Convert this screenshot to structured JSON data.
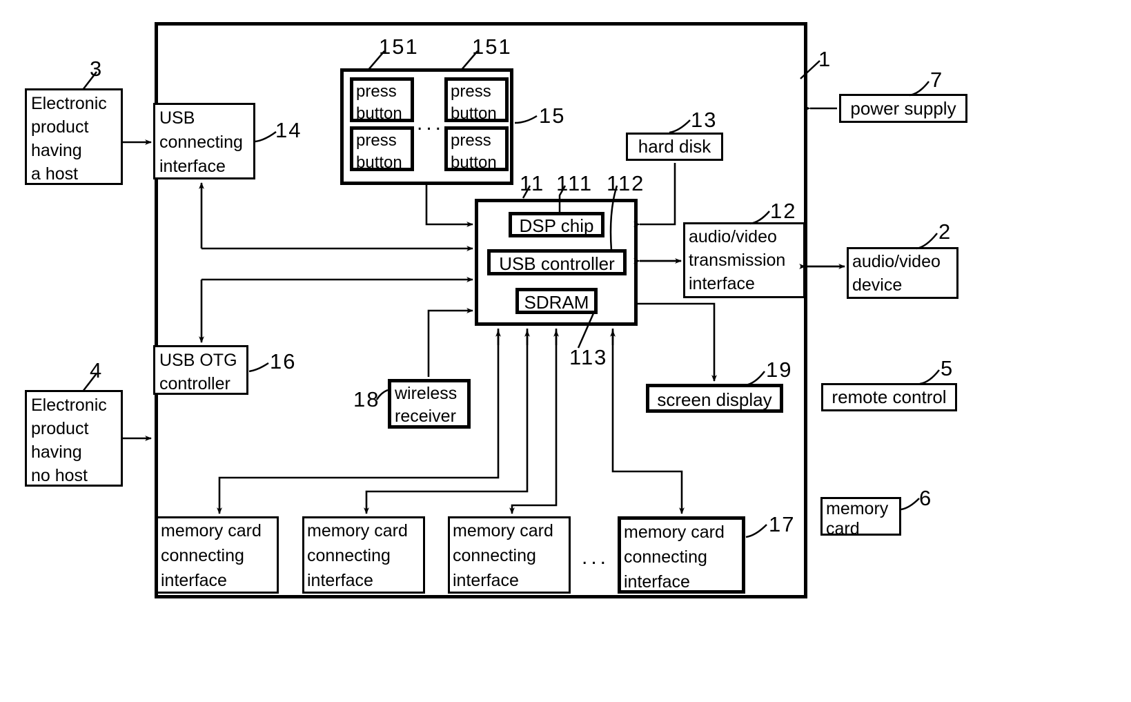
{
  "figure": {
    "title": "Patent block diagram",
    "ink_color": "#000000",
    "background": "#ffffff"
  },
  "main_frame": {
    "label": "1"
  },
  "blocks": {
    "electronic_product_host": {
      "label": "Electronic\nproduct\nhaving\na host",
      "ref": "3"
    },
    "electronic_product_no_host": {
      "label": "Electronic\nproduct\nhaving\nno host",
      "ref": "4"
    },
    "usb_connecting_interface": {
      "label": "USB\nconnecting\ninterface",
      "ref": "14"
    },
    "usb_otg_controller": {
      "label": "USB OTG\ncontroller",
      "ref": "16"
    },
    "press_button_group": {
      "ref": "15",
      "ref_button_left": "151",
      "ref_button_right": "151",
      "dots": "..."
    },
    "press_button_1": {
      "label": "press\nbutton"
    },
    "press_button_2": {
      "label": "press\nbutton"
    },
    "press_button_3": {
      "label": "press\nbutton"
    },
    "press_button_4": {
      "label": "press\nbutton"
    },
    "chip_module": {
      "ref": "11"
    },
    "dsp_chip": {
      "label": "DSP chip",
      "ref": "111"
    },
    "usb_controller": {
      "label": "USB controller",
      "ref": "112"
    },
    "sdram": {
      "label": "SDRAM",
      "ref": "113"
    },
    "hard_disk": {
      "label": "hard disk",
      "ref": "13"
    },
    "av_transmission_interface": {
      "label": "audio/video\ntransmission\ninterface",
      "ref": "12"
    },
    "av_device": {
      "label": "audio/video\ndevice",
      "ref": "2"
    },
    "power_supply": {
      "label": "power supply",
      "ref": "7"
    },
    "remote_control": {
      "label": "remote control",
      "ref": "5"
    },
    "memory_card": {
      "label": "memory\ncard",
      "ref": "6"
    },
    "wireless_receiver": {
      "label": "wireless\nreceiver",
      "ref": "18"
    },
    "screen_display": {
      "label": "screen display",
      "ref": "19"
    },
    "memory_card_if_1": {
      "label": "memory card\nconnecting\ninterface"
    },
    "memory_card_if_2": {
      "label": "memory card\nconnecting\ninterface"
    },
    "memory_card_if_3": {
      "label": "memory card\nconnecting\ninterface"
    },
    "memory_card_if_4": {
      "label": "memory card\nconnecting\ninterface",
      "ref": "17"
    },
    "memory_card_if_dots": {
      "dots": "..."
    }
  }
}
